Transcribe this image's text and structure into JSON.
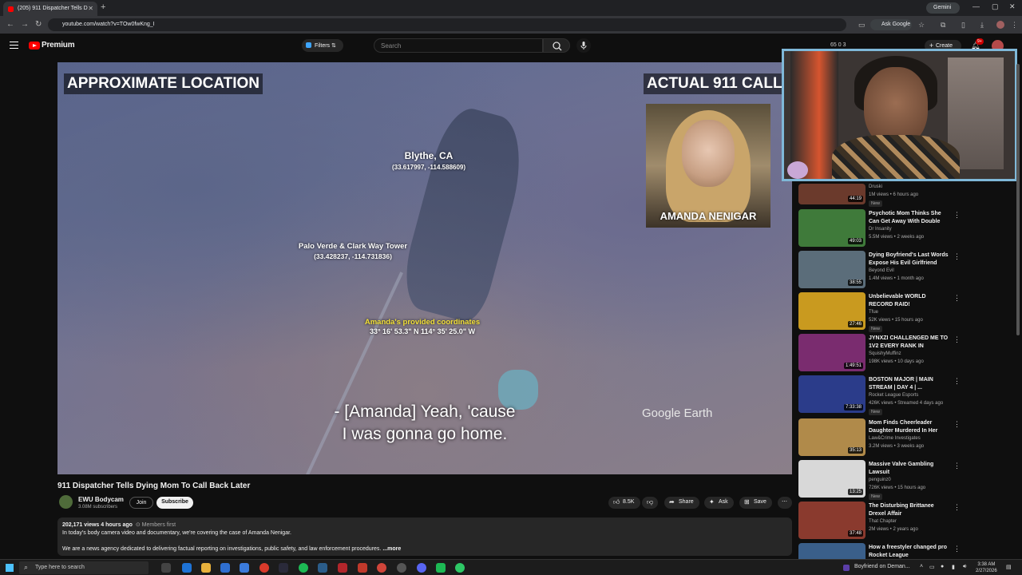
{
  "browser": {
    "tab_title": "(205) 911 Dispatcher Tells D",
    "url": "youtube.com/watch?v=TOw0fwKng_I",
    "gemini_label": "Gemini",
    "ask_google_label": "Ask Google"
  },
  "header": {
    "logo_text": "Premium",
    "filters_label": "Filters",
    "search_placeholder": "Search",
    "stats": "65   0   3",
    "create_label": "Create",
    "notif_badge": "9+"
  },
  "video": {
    "overlay_left": "APPROXIMATE LOCATION",
    "overlay_right": "ACTUAL 911 CALL",
    "caller_name": "AMANDA NENIGAR",
    "label_blythe": "Blythe, CA",
    "coords_blythe": "(33.617997, -114.588609)",
    "label_tower": "Palo Verde & Clark Way Tower",
    "coords_tower": "(33.428237, -114.731836)",
    "label_provided": "Amanda's provided coordinates",
    "coords_provided": "33° 16' 53.3\" N  114° 35' 25.0\" W",
    "caption_line1": "- [Amanda] Yeah, 'cause",
    "caption_line2": "I was gonna go home.",
    "watermark": "Google Earth",
    "title": "911 Dispatcher Tells Dying Mom To Call Back Later"
  },
  "channel": {
    "name": "EWU Bodycam",
    "subscribers": "3.08M subscribers",
    "join_label": "Join",
    "subscribe_label": "Subscribe"
  },
  "actions": {
    "likes": "8.5K",
    "share_label": "Share",
    "ask_label": "Ask",
    "save_label": "Save"
  },
  "description": {
    "meta": "202,171 views  4 hours ago",
    "members": "Members first",
    "line1": "In today's body camera video and documentary, we're covering the case of Amanda Nenigar.",
    "line2": "We are a news agency dedicated to delivering factual reporting on investigations, public safety, and law enforcement procedures.",
    "more": "...more"
  },
  "recommendations": [
    {
      "title": "",
      "channel": "Druski",
      "views": "1M views • 6 hours ago",
      "new": "New",
      "duration": "44:19",
      "color": "#6b3a2c"
    },
    {
      "title": "Psychotic Mom Thinks She Can Get Away With Double Murder",
      "channel": "Dr Insanity",
      "views": "5.5M views • 2 weeks ago",
      "new": "",
      "duration": "49:03",
      "color": "#3f7a3a"
    },
    {
      "title": "Dying Boyfriend's Last Words Expose His Evil Girlfriend",
      "channel": "Beyond Evil",
      "views": "1.4M views • 1 month ago",
      "new": "",
      "duration": "38:55",
      "color": "#5b6d7a"
    },
    {
      "title": "Unbelievable WORLD RECORD RAID!",
      "channel": "Tfue",
      "views": "52K views • 15 hours ago",
      "new": "New",
      "duration": "27:46",
      "color": "#c99a1f"
    },
    {
      "title": "JYNXZI CHALLENGED ME TO 1V2 EVERY RANK IN ROCKET ...",
      "channel": "SquishyMuffinz",
      "views": "198K views • 10 days ago",
      "new": "",
      "duration": "1:49:51",
      "color": "#7a2c6f"
    },
    {
      "title": "BOSTON MAJOR | MAIN STREAM | DAY 4 | ...",
      "channel": "Rocket League Esports",
      "views": "426K views • Streamed 4 days ago",
      "new": "New",
      "duration": "7:33:38",
      "color": "#2b3c8a"
    },
    {
      "title": "Mom Finds Cheerleader Daughter Murdered In Her Ow...",
      "channel": "Law&Crime Investigates",
      "views": "3.2M views • 3 weeks ago",
      "new": "",
      "duration": "35:13",
      "color": "#b08a4a"
    },
    {
      "title": "Massive Valve Gambling Lawsuit",
      "channel": "penguinz0",
      "views": "726K views • 15 hours ago",
      "new": "New",
      "duration": "13:25",
      "color": "#d8d8d8"
    },
    {
      "title": "The Disturbing Brittanee Drexel Affair",
      "channel": "That Chapter",
      "views": "2M views • 2 years ago",
      "new": "",
      "duration": "37:48",
      "color": "#8a3a2e"
    },
    {
      "title": "How a freestyler changed pro Rocket League",
      "channel": "",
      "views": "",
      "new": "",
      "duration": "",
      "color": "#3a5f8a"
    }
  ],
  "taskbar": {
    "search_placeholder": "Type here to search",
    "now_playing": "Boyfriend on Deman...",
    "time": "3:38 AM",
    "date": "2/27/2026"
  }
}
